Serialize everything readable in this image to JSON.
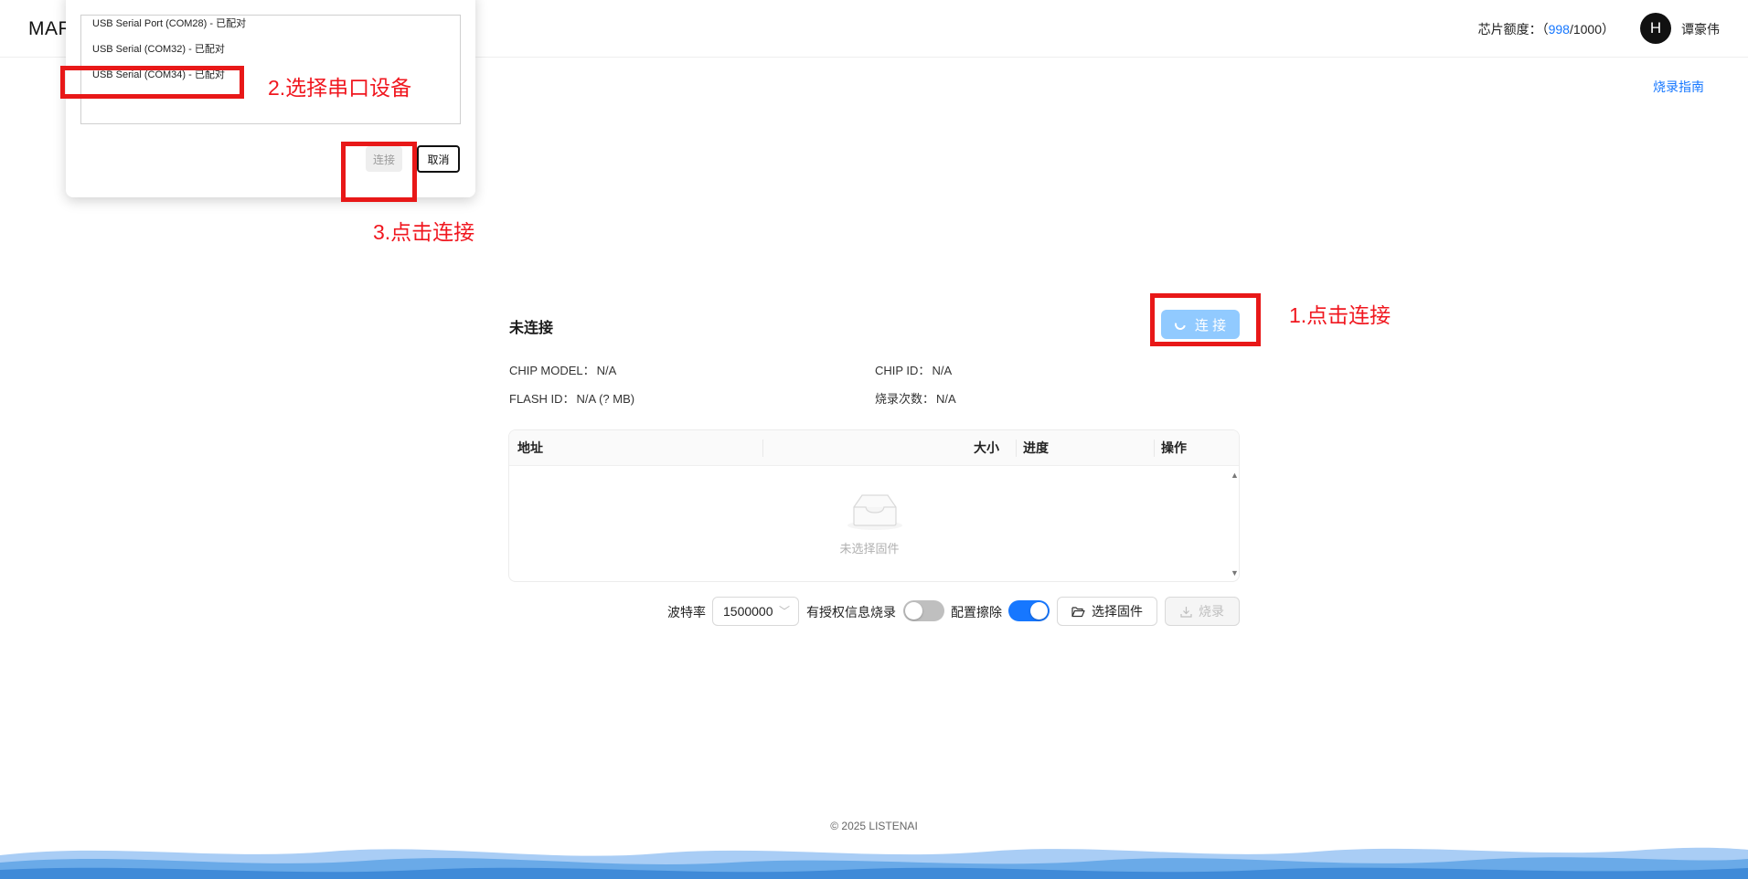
{
  "header": {
    "brand": "MAR",
    "quota_label": "芯片额度：（",
    "quota_used": "998",
    "quota_total": "/1000）",
    "avatar_letter": "H",
    "username": "谭豪伟"
  },
  "guide_link": "烧录指南",
  "device": {
    "status": "未连接",
    "connect_label": "连 接",
    "chip_model_label": "CHIP MODEL：",
    "chip_model_value": "N/A",
    "chip_id_label": "CHIP ID：",
    "chip_id_value": "N/A",
    "flash_id_label": "FLASH ID：",
    "flash_id_value": "N/A (? MB)",
    "burn_count_label": "烧录次数：",
    "burn_count_value": "N/A"
  },
  "table": {
    "columns": [
      "地址",
      "大小",
      "进度",
      "操作"
    ],
    "empty_text": "未选择固件"
  },
  "toolbar": {
    "baud_label": "波特率",
    "baud_value": "1500000",
    "auth_label": "有授权信息烧录",
    "auth_on": false,
    "erase_label": "配置擦除",
    "erase_on": true,
    "select_firmware_label": "选择固件",
    "burn_label": "烧录"
  },
  "footer": "© 2025 LISTENAI",
  "port_dialog": {
    "ports": [
      "USB Serial Port (COM28) - 已配对",
      "USB Serial (COM32) - 已配对",
      "USB Serial (COM34) - 已配对"
    ],
    "connect_label": "连接",
    "cancel_label": "取消"
  },
  "annotations": {
    "step1": "1.点击连接",
    "step2": "2.选择串口设备",
    "step3": "3.点击连接"
  },
  "colors": {
    "accent": "#1677ff",
    "connect_disabled": "#91caff",
    "annotation_red": "#e81818",
    "wave_blue": "#4a90e2"
  }
}
